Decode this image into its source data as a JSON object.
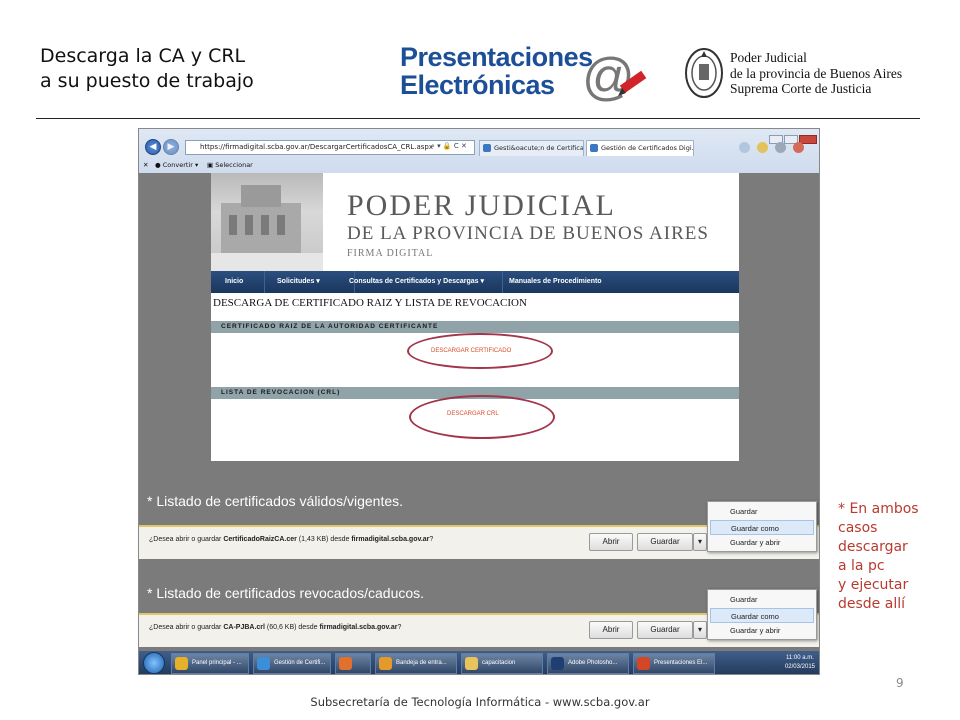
{
  "slide": {
    "title_line1": "Descarga la CA y CRL",
    "title_line2": "a su puesto de trabajo",
    "logo_line1": "Presentaciones",
    "logo_line2": "Electrónicas",
    "institution_line1": "Poder Judicial",
    "institution_line2": "de la provincia de Buenos Aires",
    "institution_line3": "Suprema Corte de Justicia",
    "side_note": [
      "* En ambos",
      "casos",
      "descargar",
      "a la pc",
      "y ejecutar",
      "desde allí"
    ],
    "page_number": "9",
    "footer": "Subsecretaría de Tecnología Informática   -   www.scba.gov.ar",
    "colors": {
      "logo_blue": "#1c4f97",
      "note_red": "#b83a2f"
    }
  },
  "browser": {
    "url": "https://firmadigital.scba.gov.ar/DescargarCertificadosCA_CRL.aspx",
    "address_controls": "⌕ ▾ 🔒 C ✕",
    "tabs": [
      "Gesti&oacute;n de Certificado...",
      "Gestión de Certificados Digi..."
    ],
    "command_bar": {
      "convert": "Convertir",
      "select": "Seleccionar"
    }
  },
  "site": {
    "title": "Poder Judicial",
    "subtitle": "de la Provincia de Buenos Aires",
    "tagline": "FIRMA DIGITAL",
    "nav": [
      "Inicio",
      "Solicitudes  ▾",
      "Consultas de Certificados y Descargas  ▾",
      "Manuales de Procedimiento"
    ],
    "heading": "DESCARGA DE CERTIFICADO RAIZ Y LISTA DE REVOCACION",
    "section1": "CERTIFICADO RAIZ DE LA AUTORIDAD CERTIFICANTE",
    "link1": "DESCARGAR CERTIFICADO",
    "section2": "LISTA DE REVOCACION (CRL)",
    "link2": "DESCARGAR CRL"
  },
  "notes": {
    "valid": "* Listado de certificados válidos/vigentes.",
    "revoked": "* Listado de certificados revocados/caducos."
  },
  "downloads": [
    {
      "prefix": "¿Desea abrir o guardar ",
      "file": "CertificadoRaizCA.cer",
      "size": " (1,43 KB) desde ",
      "site": "firmadigital.scba.gov.ar",
      "suffix": "?",
      "open": "Abrir",
      "save": "Guardar",
      "menu": [
        "Guardar",
        "Guardar como",
        "Guardar y abrir"
      ]
    },
    {
      "prefix": "¿Desea abrir o guardar ",
      "file": "CA-PJBA.crl",
      "size": " (60,6 KB) desde ",
      "site": "firmadigital.scba.gov.ar",
      "suffix": "?",
      "open": "Abrir",
      "save": "Guardar",
      "menu": [
        "Guardar",
        "Guardar como",
        "Guardar y abrir"
      ]
    }
  ],
  "taskbar": {
    "items": [
      "Panel principal - ...",
      "Gestión de Certifi...",
      "",
      "Bandeja de entra...",
      "capacitacion",
      "Adobe Photosho...",
      "Presentaciones El..."
    ],
    "time": "11:00 a.m.",
    "date": "02/03/2015"
  }
}
